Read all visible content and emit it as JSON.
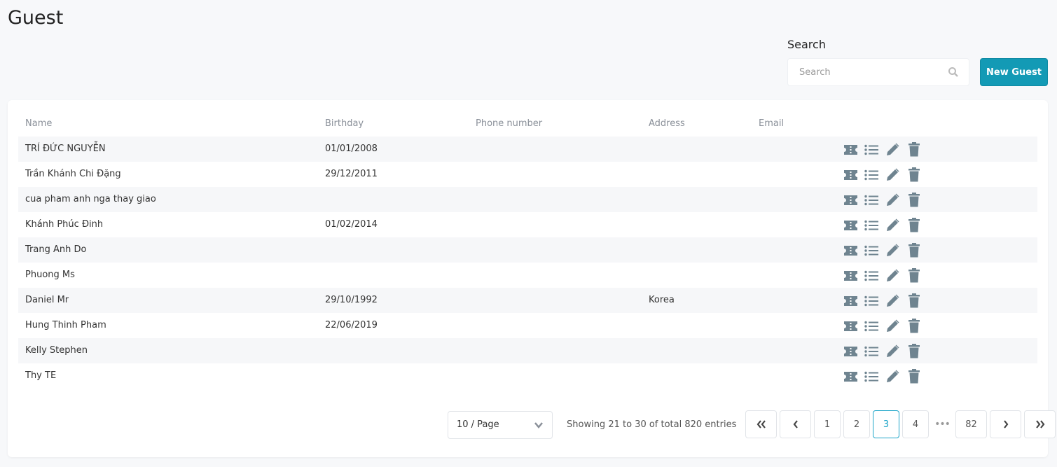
{
  "page": {
    "title": "Guest"
  },
  "search": {
    "label": "Search",
    "placeholder": "Search",
    "value": ""
  },
  "toolbar": {
    "new_label": "New Guest"
  },
  "table": {
    "columns": [
      "Name",
      "Birthday",
      "Phone number",
      "Address",
      "Email"
    ],
    "rows": [
      {
        "name": "TRÍ ĐỨC NGUYỄN",
        "birthday": "01/01/2008",
        "phone": "",
        "address": "",
        "email": ""
      },
      {
        "name": "Trần Khánh Chi Đặng",
        "birthday": "29/12/2011",
        "phone": "",
        "address": "",
        "email": ""
      },
      {
        "name": "cua pham anh nga thay giao",
        "birthday": "",
        "phone": "",
        "address": "",
        "email": ""
      },
      {
        "name": "Khánh Phúc Đinh",
        "birthday": "01/02/2014",
        "phone": "",
        "address": "",
        "email": ""
      },
      {
        "name": "Trang Anh Do",
        "birthday": "",
        "phone": "",
        "address": "",
        "email": ""
      },
      {
        "name": "Phuong Ms",
        "birthday": "",
        "phone": "",
        "address": "",
        "email": ""
      },
      {
        "name": "Daniel Mr",
        "birthday": "29/10/1992",
        "phone": "",
        "address": "Korea",
        "email": ""
      },
      {
        "name": "Hung Thinh Pham",
        "birthday": "22/06/2019",
        "phone": "",
        "address": "",
        "email": ""
      },
      {
        "name": "Kelly Stephen",
        "birthday": "",
        "phone": "",
        "address": "",
        "email": ""
      },
      {
        "name": "Thy TE",
        "birthday": "",
        "phone": "",
        "address": "",
        "email": ""
      }
    ],
    "row_actions": [
      "ticket-icon",
      "list-icon",
      "edit-icon",
      "trash-icon"
    ]
  },
  "pagination": {
    "page_size": "10 / Page",
    "info": "Showing 21 to 30 of total 820 entries",
    "pages": [
      "1",
      "2",
      "3",
      "4",
      "82"
    ],
    "current": "3",
    "ellipsis": "•••"
  },
  "colors": {
    "accent": "#139ab5",
    "icon": "#6f8490"
  }
}
